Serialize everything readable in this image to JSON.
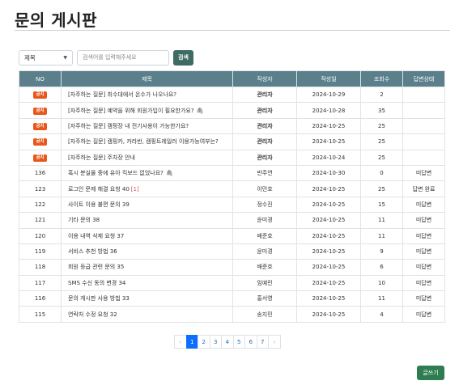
{
  "page": {
    "title": "문의 게시판"
  },
  "search": {
    "select_value": "제목",
    "placeholder": "검색어를 입력해주세요",
    "button_label": "검색"
  },
  "table": {
    "headers": {
      "no": "NO",
      "title": "제목",
      "author": "작성자",
      "date": "작성일",
      "views": "조회수",
      "status": "답변상태"
    },
    "notice_label": "공지",
    "notices": [
      {
        "title": "[자주하는 질문] 취수대에서 온수가 나오나요?",
        "author": "관리자",
        "date": "2024-10-29",
        "views": "2",
        "status": "",
        "attachment": false
      },
      {
        "title": "[자주하는 질문] 예약을 위해 회원가입이 필요한가요?",
        "author": "관리자",
        "date": "2024-10-28",
        "views": "35",
        "status": "",
        "attachment": true
      },
      {
        "title": "[자주하는 질문] 캠핑장 내 전기사용이 가능한가요?",
        "author": "관리자",
        "date": "2024-10-25",
        "views": "25",
        "status": "",
        "attachment": false
      },
      {
        "title": "[자주하는 질문] 캠핑카, 카라반, 캠핑트레일러 이용가능여부는?",
        "author": "관리자",
        "date": "2024-10-25",
        "views": "25",
        "status": "",
        "attachment": false
      },
      {
        "title": "[자주하는 질문] 주차장 안내",
        "author": "관리자",
        "date": "2024-10-24",
        "views": "25",
        "status": "",
        "attachment": false
      }
    ],
    "rows": [
      {
        "no": "136",
        "title": "혹시 분실물 중에 유아 킥보드 없었나요?",
        "comments": "",
        "author": "반주연",
        "date": "2024-10-30",
        "views": "0",
        "status": "미답변",
        "attachment": true
      },
      {
        "no": "123",
        "title": "로그인 문제 해결 요청 40",
        "comments": "[1]",
        "author": "이민호",
        "date": "2024-10-25",
        "views": "25",
        "status": "답변 완료",
        "attachment": false
      },
      {
        "no": "122",
        "title": "사이트 이용 불편 문의 39",
        "comments": "",
        "author": "정수진",
        "date": "2024-10-25",
        "views": "15",
        "status": "미답변",
        "attachment": false
      },
      {
        "no": "121",
        "title": "기타 문의 38",
        "comments": "",
        "author": "윤미경",
        "date": "2024-10-25",
        "views": "11",
        "status": "미답변",
        "attachment": false
      },
      {
        "no": "120",
        "title": "이용 내역 삭제 요청 37",
        "comments": "",
        "author": "배준호",
        "date": "2024-10-25",
        "views": "11",
        "status": "미답변",
        "attachment": false
      },
      {
        "no": "119",
        "title": "서비스 추천 방법 36",
        "comments": "",
        "author": "윤미경",
        "date": "2024-10-25",
        "views": "9",
        "status": "미답변",
        "attachment": false
      },
      {
        "no": "118",
        "title": "회원 등급 관련 문의 35",
        "comments": "",
        "author": "배준호",
        "date": "2024-10-25",
        "views": "6",
        "status": "미답변",
        "attachment": false
      },
      {
        "no": "117",
        "title": "SMS 수신 동의 변경 34",
        "comments": "",
        "author": "임예린",
        "date": "2024-10-25",
        "views": "10",
        "status": "미답변",
        "attachment": false
      },
      {
        "no": "116",
        "title": "문의 게시판 사용 방법 33",
        "comments": "",
        "author": "홍서영",
        "date": "2024-10-25",
        "views": "11",
        "status": "미답변",
        "attachment": false
      },
      {
        "no": "115",
        "title": "연락처 수정 요청 32",
        "comments": "",
        "author": "송지민",
        "date": "2024-10-25",
        "views": "4",
        "status": "미답변",
        "attachment": false
      }
    ]
  },
  "pagination": {
    "prev": "‹",
    "next": "›",
    "pages": [
      "1",
      "2",
      "3",
      "4",
      "5",
      "6",
      "7"
    ],
    "current": "1"
  },
  "write_button": "글쓰기"
}
